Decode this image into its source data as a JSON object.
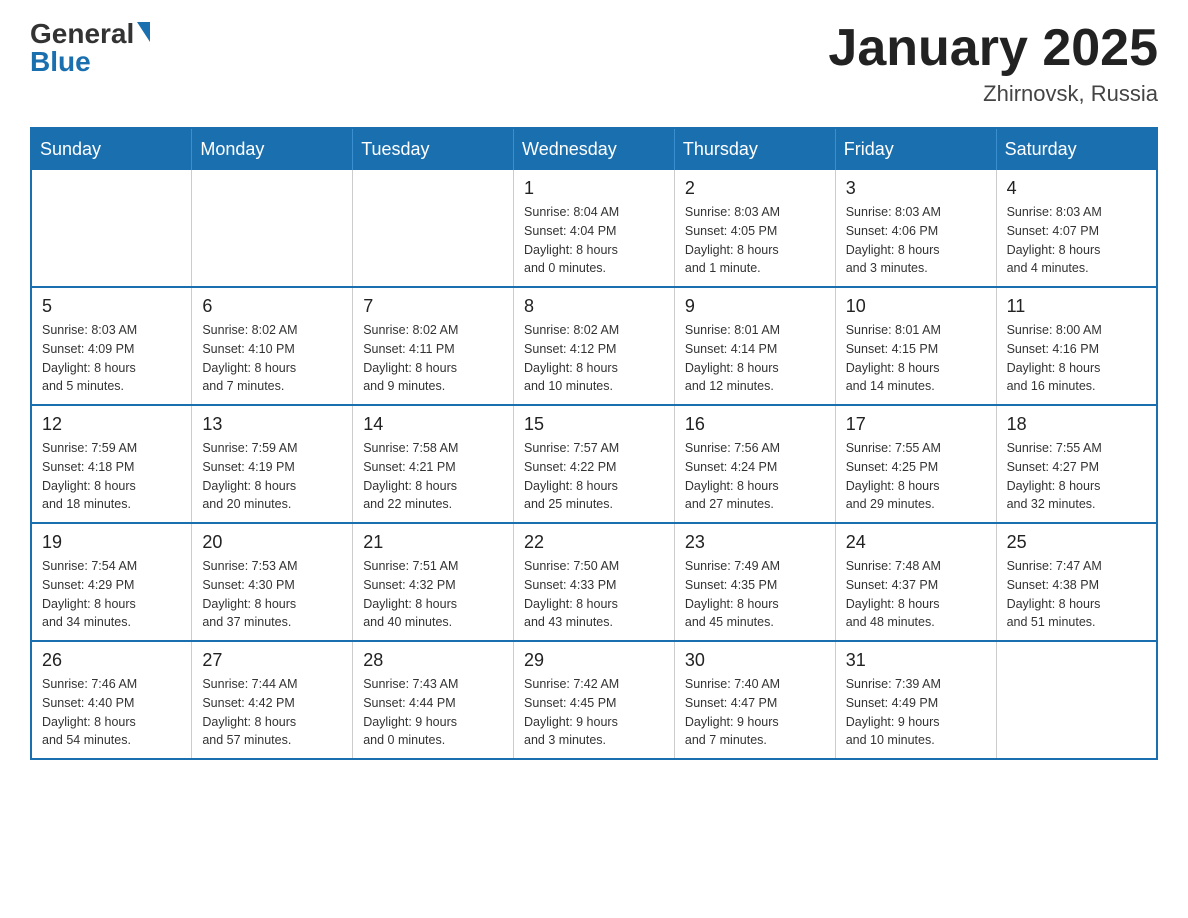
{
  "header": {
    "logo_general": "General",
    "logo_blue": "Blue",
    "month_title": "January 2025",
    "location": "Zhirnovsk, Russia"
  },
  "calendar": {
    "days_of_week": [
      "Sunday",
      "Monday",
      "Tuesday",
      "Wednesday",
      "Thursday",
      "Friday",
      "Saturday"
    ],
    "weeks": [
      [
        {
          "day": "",
          "info": ""
        },
        {
          "day": "",
          "info": ""
        },
        {
          "day": "",
          "info": ""
        },
        {
          "day": "1",
          "info": "Sunrise: 8:04 AM\nSunset: 4:04 PM\nDaylight: 8 hours\nand 0 minutes."
        },
        {
          "day": "2",
          "info": "Sunrise: 8:03 AM\nSunset: 4:05 PM\nDaylight: 8 hours\nand 1 minute."
        },
        {
          "day": "3",
          "info": "Sunrise: 8:03 AM\nSunset: 4:06 PM\nDaylight: 8 hours\nand 3 minutes."
        },
        {
          "day": "4",
          "info": "Sunrise: 8:03 AM\nSunset: 4:07 PM\nDaylight: 8 hours\nand 4 minutes."
        }
      ],
      [
        {
          "day": "5",
          "info": "Sunrise: 8:03 AM\nSunset: 4:09 PM\nDaylight: 8 hours\nand 5 minutes."
        },
        {
          "day": "6",
          "info": "Sunrise: 8:02 AM\nSunset: 4:10 PM\nDaylight: 8 hours\nand 7 minutes."
        },
        {
          "day": "7",
          "info": "Sunrise: 8:02 AM\nSunset: 4:11 PM\nDaylight: 8 hours\nand 9 minutes."
        },
        {
          "day": "8",
          "info": "Sunrise: 8:02 AM\nSunset: 4:12 PM\nDaylight: 8 hours\nand 10 minutes."
        },
        {
          "day": "9",
          "info": "Sunrise: 8:01 AM\nSunset: 4:14 PM\nDaylight: 8 hours\nand 12 minutes."
        },
        {
          "day": "10",
          "info": "Sunrise: 8:01 AM\nSunset: 4:15 PM\nDaylight: 8 hours\nand 14 minutes."
        },
        {
          "day": "11",
          "info": "Sunrise: 8:00 AM\nSunset: 4:16 PM\nDaylight: 8 hours\nand 16 minutes."
        }
      ],
      [
        {
          "day": "12",
          "info": "Sunrise: 7:59 AM\nSunset: 4:18 PM\nDaylight: 8 hours\nand 18 minutes."
        },
        {
          "day": "13",
          "info": "Sunrise: 7:59 AM\nSunset: 4:19 PM\nDaylight: 8 hours\nand 20 minutes."
        },
        {
          "day": "14",
          "info": "Sunrise: 7:58 AM\nSunset: 4:21 PM\nDaylight: 8 hours\nand 22 minutes."
        },
        {
          "day": "15",
          "info": "Sunrise: 7:57 AM\nSunset: 4:22 PM\nDaylight: 8 hours\nand 25 minutes."
        },
        {
          "day": "16",
          "info": "Sunrise: 7:56 AM\nSunset: 4:24 PM\nDaylight: 8 hours\nand 27 minutes."
        },
        {
          "day": "17",
          "info": "Sunrise: 7:55 AM\nSunset: 4:25 PM\nDaylight: 8 hours\nand 29 minutes."
        },
        {
          "day": "18",
          "info": "Sunrise: 7:55 AM\nSunset: 4:27 PM\nDaylight: 8 hours\nand 32 minutes."
        }
      ],
      [
        {
          "day": "19",
          "info": "Sunrise: 7:54 AM\nSunset: 4:29 PM\nDaylight: 8 hours\nand 34 minutes."
        },
        {
          "day": "20",
          "info": "Sunrise: 7:53 AM\nSunset: 4:30 PM\nDaylight: 8 hours\nand 37 minutes."
        },
        {
          "day": "21",
          "info": "Sunrise: 7:51 AM\nSunset: 4:32 PM\nDaylight: 8 hours\nand 40 minutes."
        },
        {
          "day": "22",
          "info": "Sunrise: 7:50 AM\nSunset: 4:33 PM\nDaylight: 8 hours\nand 43 minutes."
        },
        {
          "day": "23",
          "info": "Sunrise: 7:49 AM\nSunset: 4:35 PM\nDaylight: 8 hours\nand 45 minutes."
        },
        {
          "day": "24",
          "info": "Sunrise: 7:48 AM\nSunset: 4:37 PM\nDaylight: 8 hours\nand 48 minutes."
        },
        {
          "day": "25",
          "info": "Sunrise: 7:47 AM\nSunset: 4:38 PM\nDaylight: 8 hours\nand 51 minutes."
        }
      ],
      [
        {
          "day": "26",
          "info": "Sunrise: 7:46 AM\nSunset: 4:40 PM\nDaylight: 8 hours\nand 54 minutes."
        },
        {
          "day": "27",
          "info": "Sunrise: 7:44 AM\nSunset: 4:42 PM\nDaylight: 8 hours\nand 57 minutes."
        },
        {
          "day": "28",
          "info": "Sunrise: 7:43 AM\nSunset: 4:44 PM\nDaylight: 9 hours\nand 0 minutes."
        },
        {
          "day": "29",
          "info": "Sunrise: 7:42 AM\nSunset: 4:45 PM\nDaylight: 9 hours\nand 3 minutes."
        },
        {
          "day": "30",
          "info": "Sunrise: 7:40 AM\nSunset: 4:47 PM\nDaylight: 9 hours\nand 7 minutes."
        },
        {
          "day": "31",
          "info": "Sunrise: 7:39 AM\nSunset: 4:49 PM\nDaylight: 9 hours\nand 10 minutes."
        },
        {
          "day": "",
          "info": ""
        }
      ]
    ]
  }
}
